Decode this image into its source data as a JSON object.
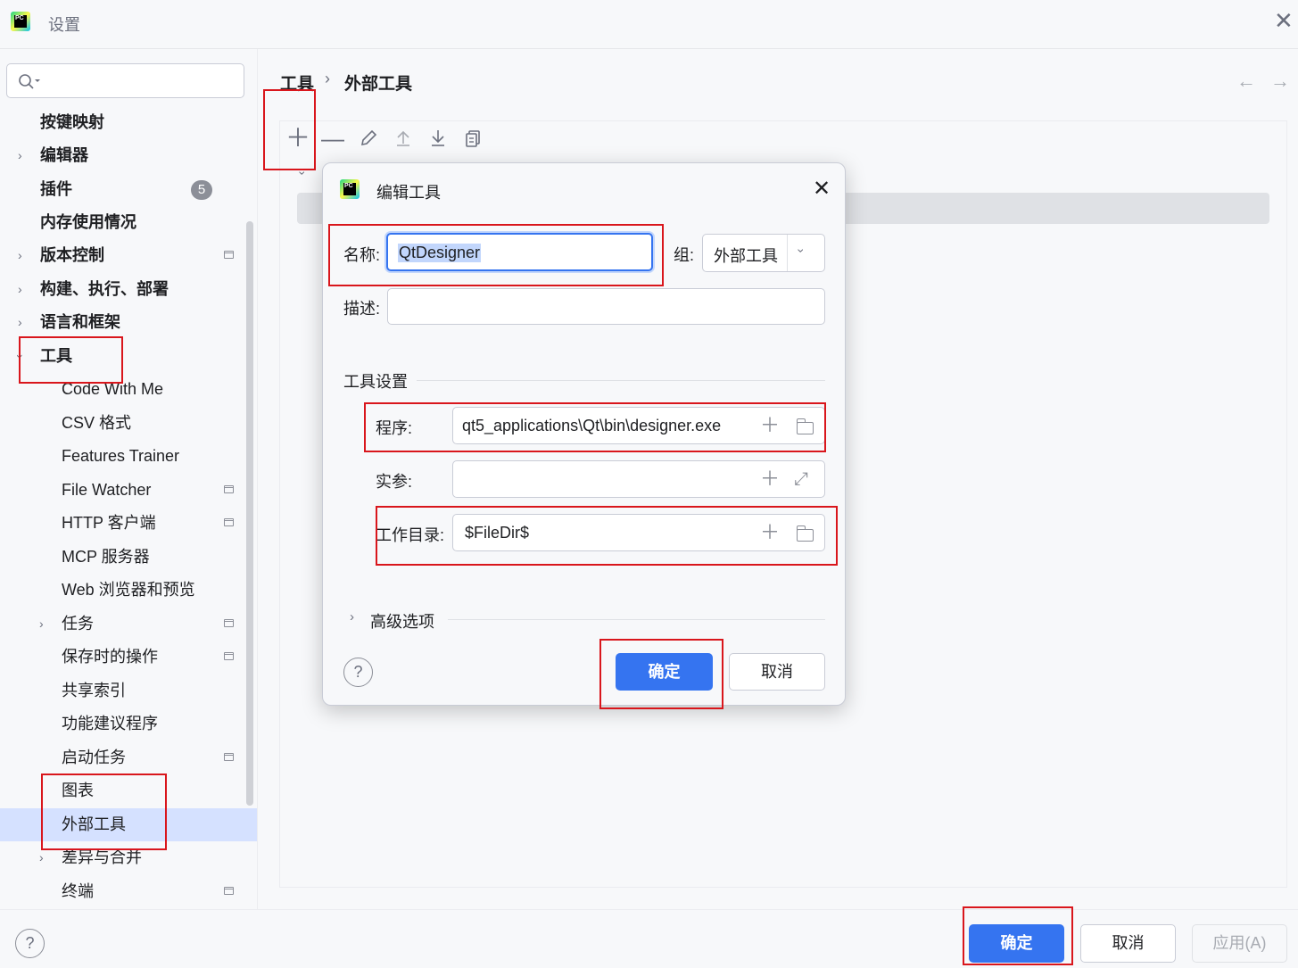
{
  "window": {
    "title": "设置",
    "logo_text": "PC"
  },
  "sidebar": {
    "search_placeholder": "",
    "items": [
      {
        "label": "按键映射"
      },
      {
        "label": "编辑器"
      },
      {
        "label": "插件",
        "badge": "5"
      },
      {
        "label": "内存使用情况"
      },
      {
        "label": "版本控制"
      },
      {
        "label": "构建、执行、部署"
      },
      {
        "label": "语言和框架"
      },
      {
        "label": "工具"
      },
      {
        "label": "Code With Me"
      },
      {
        "label": "CSV 格式"
      },
      {
        "label": "Features Trainer"
      },
      {
        "label": "File Watcher"
      },
      {
        "label": "HTTP 客户端"
      },
      {
        "label": "MCP 服务器"
      },
      {
        "label": "Web 浏览器和预览"
      },
      {
        "label": "任务"
      },
      {
        "label": "保存时的操作"
      },
      {
        "label": "共享索引"
      },
      {
        "label": "功能建议程序"
      },
      {
        "label": "启动任务"
      },
      {
        "label": "图表"
      },
      {
        "label": "外部工具"
      },
      {
        "label": "差异与合并"
      },
      {
        "label": "终端"
      }
    ]
  },
  "main": {
    "breadcrumb": {
      "parent": "工具",
      "separator": "›",
      "current": "外部工具"
    },
    "nav": {
      "back": "←",
      "forward": "→"
    }
  },
  "dialog": {
    "title": "编辑工具",
    "logo_text": "PC",
    "name_label": "名称:",
    "name_value": "QtDesigner",
    "group_label": "组:",
    "group_value": "外部工具",
    "description_label": "描述:",
    "description_value": "",
    "section_title": "工具设置",
    "program_label": "程序:",
    "program_value": "qt5_applications\\Qt\\bin\\designer.exe",
    "arguments_label": "实参:",
    "arguments_value": "",
    "workdir_label": "工作目录:",
    "workdir_value": "$FileDir$",
    "advanced_label": "高级选项",
    "ok_label": "确定",
    "cancel_label": "取消",
    "help": "?"
  },
  "footer": {
    "help": "?",
    "ok_label": "确定",
    "cancel_label": "取消",
    "apply_label": "应用(A)"
  },
  "colors": {
    "accent": "#3574f0",
    "highlight_red": "#d9161c",
    "selection": "#d5e1ff"
  }
}
